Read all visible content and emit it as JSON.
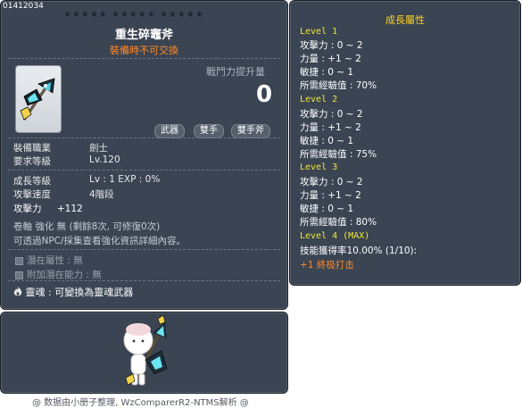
{
  "item_id": "01412034",
  "stars_text": "★★★★★  ★★★★★  ★★★★★",
  "item": {
    "name": "重生碎竈斧",
    "trade_note": "裝備時不可交換",
    "power_label": "戰鬥力提升量",
    "power_value": "0",
    "tags": [
      "武器",
      "雙手",
      "雙手斧"
    ]
  },
  "stats": {
    "job_label": "裝備職業",
    "job_value": "劍士",
    "req_level_label": "要求等級",
    "req_level_value": "Lv.120",
    "growth_level_label": "成長等級",
    "growth_level_value": "Lv : 1   EXP : 0%",
    "attack_speed_label": "攻擊速度",
    "attack_speed_value": "4階段",
    "attack_label": "攻擊力",
    "attack_value": "+112",
    "upgrade_line": "卷軸 強化 無 (剩餘8次, 可修復0次)",
    "enhance_note": "可透過NPC/採集查看強化資訊詳細內容。"
  },
  "potential": {
    "potential_label": "潛在屬性",
    "potential_value": "無",
    "additional_label": "附加潛在能力",
    "additional_value": "無"
  },
  "soul": {
    "label": "靈魂",
    "value": "可變換為靈魂武器"
  },
  "growth": {
    "title": "成長屬性",
    "levels": [
      {
        "name": "Level 1",
        "atk": "攻擊力 : 0 ~ 2",
        "str": "力量 : +1 ~ 2",
        "dex": "敏捷 : 0 ~ 1",
        "exp": "所需經驗值 : 70%"
      },
      {
        "name": "Level 2",
        "atk": "攻擊力 : 0 ~ 2",
        "str": "力量 : +1 ~ 2",
        "dex": "敏捷 : 0 ~ 1",
        "exp": "所需經驗值 : 75%"
      },
      {
        "name": "Level 3",
        "atk": "攻擊力 : 0 ~ 2",
        "str": "力量 : +1 ~ 2",
        "dex": "敏捷 : 0 ~ 1",
        "exp": "所需經驗值 : 80%"
      }
    ],
    "level4_name": "Level 4 (MAX)",
    "level4_line": "技能獲得率10.00% (1/10):",
    "level4_skill": "+1 終极打击"
  },
  "footer": "@ 数据由小册子整理, WzComparerR2-NTMS解析 @",
  "icons": {
    "weapon": "double-axe-icon",
    "soul": "flame-icon",
    "character": "character-preview"
  },
  "colors": {
    "panel_bg": "#3a4452",
    "title_yellow": "#ffd11a",
    "orange": "#ff8a2a",
    "level_yellow": "#f0e636"
  }
}
